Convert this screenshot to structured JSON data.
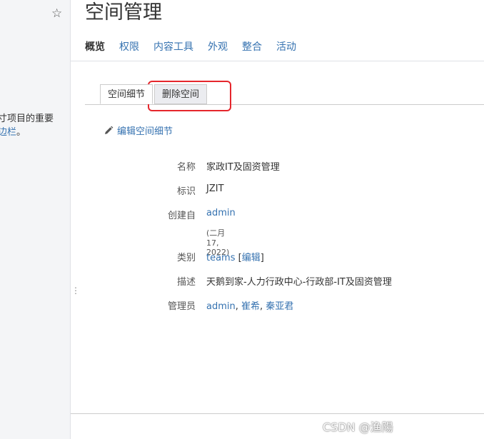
{
  "page": {
    "title": "空间管理"
  },
  "sidebar": {
    "star": "☆",
    "text_line1": "寸项目的重要",
    "text_line2_link": "边栏",
    "text_line2_suffix": "。",
    "handle": "⋮"
  },
  "nav": {
    "items": [
      "概览",
      "权限",
      "内容工具",
      "外观",
      "整合",
      "活动"
    ],
    "active": "概览"
  },
  "tabs": {
    "items": [
      "空间细节",
      "删除空间"
    ],
    "active": "空间细节",
    "highlighted": "删除空间"
  },
  "edit_link": "编辑空间细节",
  "details": {
    "name_label": "名称",
    "name_value": "家政IT及固资管理",
    "key_label": "标识",
    "key_value": "JZIT",
    "creator_label": "创建自",
    "creator_value": "admin",
    "created_date": "(二月 17, 2022)",
    "category_label": "类别",
    "category_value": "teams",
    "category_edit": "编辑",
    "desc_label": "描述",
    "desc_value": "天鹅到家-人力行政中心-行政部-IT及固资管理",
    "admins_label": "管理员",
    "admins": [
      "admin",
      "崔希",
      "秦亚君"
    ]
  },
  "watermark": "CSDN @渔陽",
  "colors": {
    "link": "#3572b0",
    "highlight": "#e5262c",
    "sidebar_bg": "#f4f5f7"
  }
}
